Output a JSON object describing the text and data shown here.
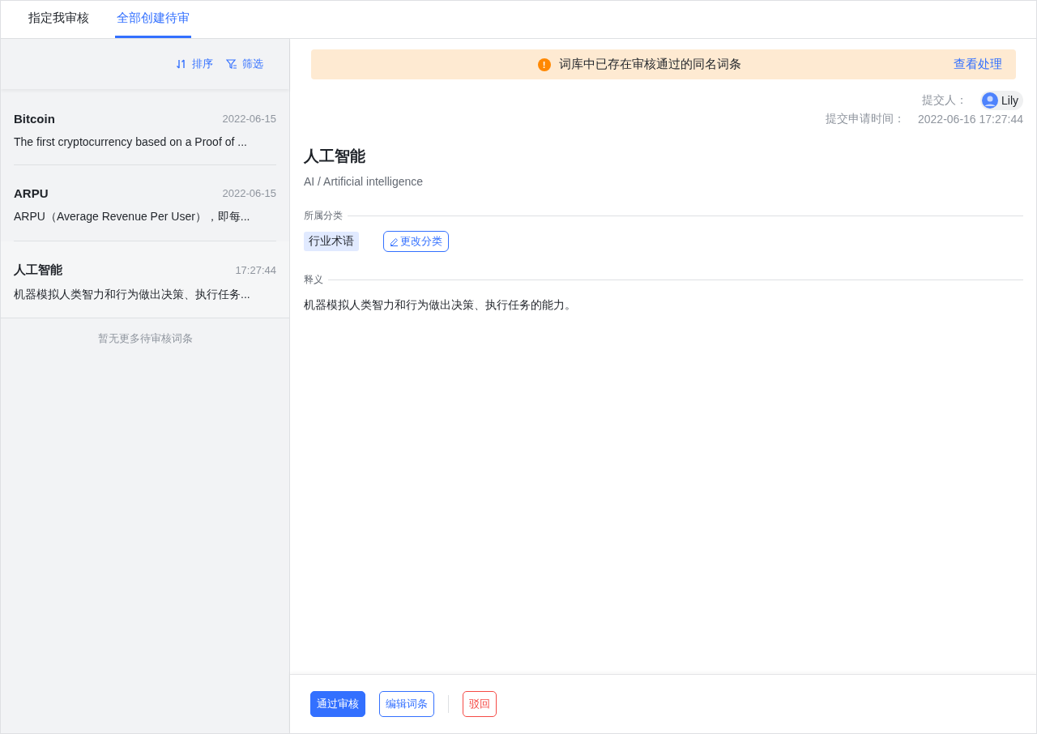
{
  "tabs": [
    {
      "label": "指定我审核",
      "selected": false
    },
    {
      "label": "全部创建待审",
      "selected": true
    }
  ],
  "toolbar": {
    "sort": "排序",
    "filter": "筛选"
  },
  "items": [
    {
      "title": "Bitcoin",
      "date": "2022-06-15",
      "summary": "The first cryptocurrency based on a Proof of ...",
      "selected": false
    },
    {
      "title": "ARPU",
      "date": "2022-06-15",
      "summary": "ARPU（Average Revenue Per User），即每...",
      "selected": false
    },
    {
      "title": "人工智能",
      "date": "17:27:44",
      "summary": "机器模拟人类智力和行为做出决策、执行任务...",
      "selected": true
    }
  ],
  "list_end": "暂无更多待审核词条",
  "alert": {
    "icon": "!",
    "message": "词库中已存在审核通过的同名词条",
    "action": "查看处理"
  },
  "submitter": {
    "label": "提交人：",
    "name": "Lily"
  },
  "submit_time": {
    "label": "提交申请时间：",
    "value": "2022-06-16 17:27:44"
  },
  "term": {
    "title": "人工智能",
    "subtitle": "AI / Artificial intelligence"
  },
  "category": {
    "heading": "所属分类",
    "tag": "行业术语",
    "change": "更改分类"
  },
  "definition": {
    "heading": "释义",
    "text": "机器模拟人类智力和行为做出决策、执行任务的能力。"
  },
  "actions": [
    {
      "label": "通过审核",
      "kind": "primary"
    },
    {
      "label": "编辑词条",
      "kind": "outline"
    },
    {
      "label": "驳回",
      "kind": "danger"
    }
  ]
}
